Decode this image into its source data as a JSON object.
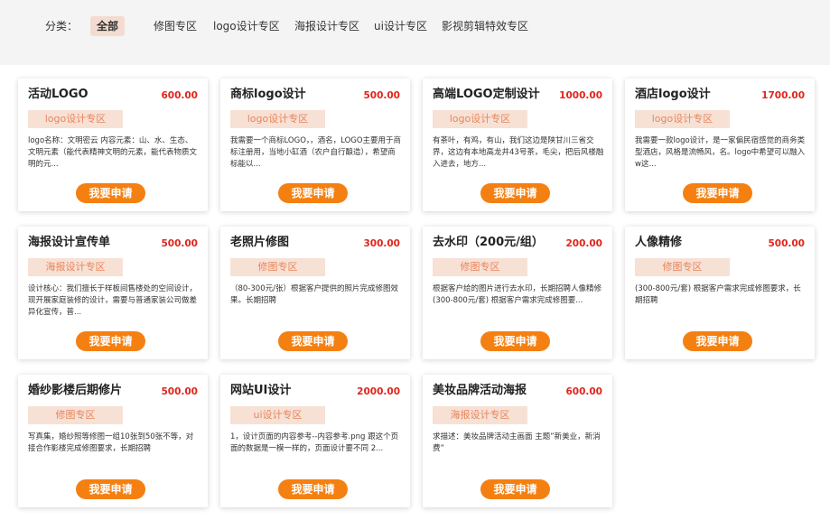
{
  "filter": {
    "label": "分类：",
    "items": [
      "全部",
      "修图专区",
      "logo设计专区",
      "海报设计专区",
      "ui设计专区",
      "影视剪辑特效专区"
    ]
  },
  "button_label": "我要申请",
  "cards": [
    {
      "title": "活动LOGO",
      "price": "600.00",
      "tag": "logo设计专区",
      "desc": "logo名称：文明密云 内容元素：山、水、生态、文明元素（能代表精神文明的元素，能代表物质文明的元..."
    },
    {
      "title": "商标logo设计",
      "price": "500.00",
      "tag": "logo设计专区",
      "desc": "我需要一个商标LOGO，，酒名，LOGO主要用于商标注册用，当地小缸酒（农户自行酿造），希望商标能以..."
    },
    {
      "title": "高端LOGO定制设计",
      "price": "1000.00",
      "tag": "logo设计专区",
      "desc": "有茶叶，有鸡，有山，我们这边是陕甘川三省交界，这边有本地高龙井43号茶，毛尖，把后风楼融入进去，地方..."
    },
    {
      "title": "酒店logo设计",
      "price": "1700.00",
      "tag": "logo设计专区",
      "desc": "我需要一款logo设计，是一家偏民宿感觉的商务类型酒店，风格是流畅风，名。logo中希望可以融入w这..."
    },
    {
      "title": "海报设计宣传单",
      "price": "500.00",
      "tag": "海报设计专区",
      "desc": "设计核心：我们擅长于样板间售楼处的空间设计，现开展家庭装修的设计，需要与普通家装公司做差异化宣传，普..."
    },
    {
      "title": "老照片修图",
      "price": "300.00",
      "tag": "修图专区",
      "desc": "（80-300元/张）根据客户提供的照片完成修图效果。长期招聘"
    },
    {
      "title": "去水印（200元/组）",
      "price": "200.00",
      "tag": "修图专区",
      "desc": "根据客户给的图片进行去水印，长期招聘人像精修(300-800元/套) 根据客户需求完成修图要..."
    },
    {
      "title": "人像精修",
      "price": "500.00",
      "tag": "修图专区",
      "desc": "(300-800元/套) 根据客户需求完成修图要求，长期招聘"
    },
    {
      "title": "婚纱影楼后期修片",
      "price": "500.00",
      "tag": "修图专区",
      "desc": "写真集，婚纱照等修图一组10张到50张不等，对接合作影楼完成修图要求，长期招聘"
    },
    {
      "title": "网站UI设计",
      "price": "2000.00",
      "tag": "ui设计专区",
      "desc": "1，设计页面的内容参考--内容参考.png 跟这个页面的数据是一模一样的，页面设计要不同 2..."
    },
    {
      "title": "美妆品牌活动海报",
      "price": "600.00",
      "tag": "海报设计专区",
      "desc": "求描述：美妆品牌活动主画面 主题”新美业，新消费”"
    }
  ]
}
